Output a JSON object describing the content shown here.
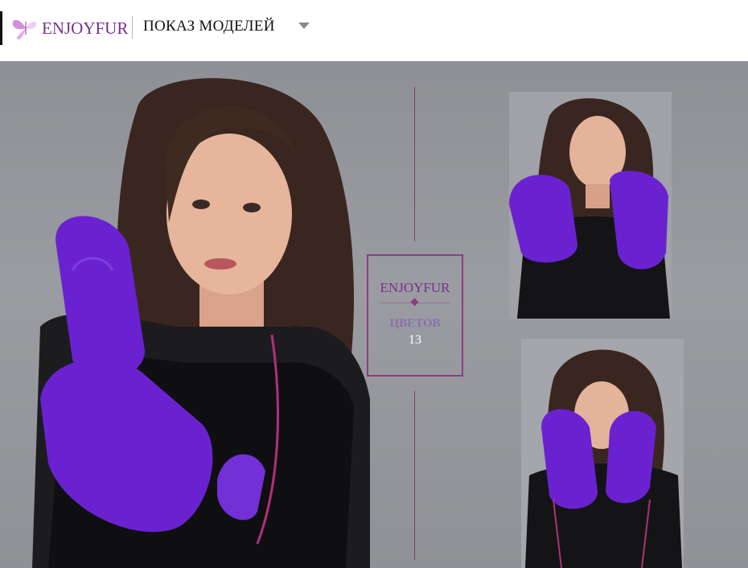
{
  "header": {
    "logo_text": "ENJOYFUR",
    "section_title": "ПОКАЗ МОДЕЛЕЙ",
    "dropdown_icon": "caret-down-icon"
  },
  "banner": {
    "badge": {
      "brand": "ENJOYFUR",
      "label": "ЦВЕТОВ",
      "count": "13"
    },
    "colors": {
      "background": "#9a9ca1",
      "accent": "#8b3d82",
      "mitten": "#6a22d0"
    }
  }
}
